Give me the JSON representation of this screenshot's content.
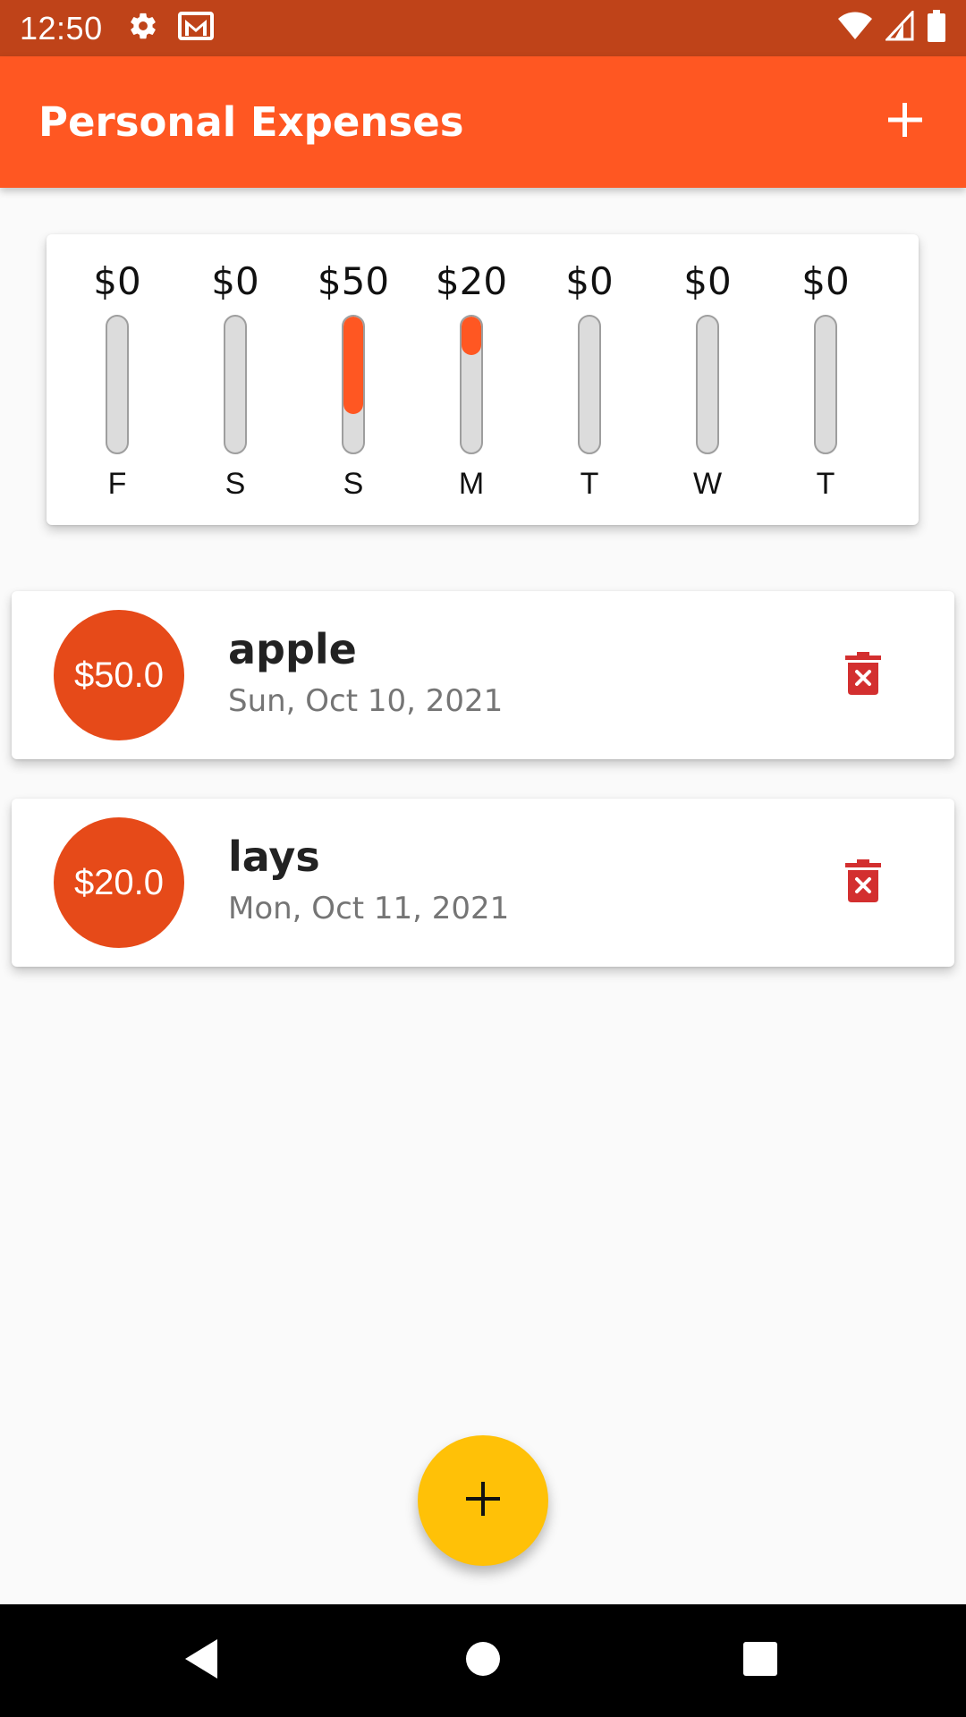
{
  "status_bar": {
    "time": "12:50",
    "left_icons": [
      "gear-icon",
      "gmail-icon"
    ],
    "right_icons": [
      "wifi-icon",
      "signal-icon",
      "battery-icon"
    ]
  },
  "app_bar": {
    "title": "Personal Expenses",
    "action_icon": "add-icon"
  },
  "chart_data": {
    "type": "bar",
    "categories": [
      "F",
      "S",
      "S",
      "M",
      "T",
      "W",
      "T"
    ],
    "amount_labels": [
      "$0",
      "$0",
      "$50",
      "$20",
      "$0",
      "$0",
      "$0"
    ],
    "values": [
      0,
      0,
      50,
      20,
      0,
      0,
      0
    ],
    "fill_fractions": [
      0,
      0,
      0.714,
      0.286,
      0,
      0,
      0
    ],
    "colors": {
      "fill": "#ff5722",
      "track": "#dcdcdc"
    }
  },
  "transactions": [
    {
      "amount": "$50.0",
      "title": "apple",
      "date": "Sun, Oct 10, 2021",
      "delete_icon": "delete-forever-icon"
    },
    {
      "amount": "$20.0",
      "title": "lays",
      "date": "Mon, Oct 11, 2021",
      "delete_icon": "delete-forever-icon"
    }
  ],
  "fab": {
    "icon": "add-icon",
    "color": "#ffc107"
  },
  "nav_bar": {
    "buttons": [
      "back-icon",
      "home-icon",
      "recents-icon"
    ]
  },
  "theme": {
    "primary": "#ff5722",
    "primary_dark": "#bf4319",
    "avatar": "#e64a19",
    "delete": "#d32f2f"
  }
}
